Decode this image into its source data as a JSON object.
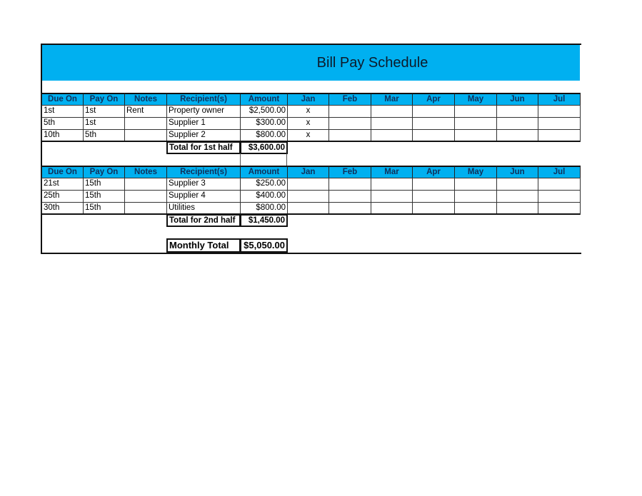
{
  "title": "Bill Pay Schedule",
  "columns": [
    "Due On",
    "Pay On",
    "Notes",
    "Recipient(s)",
    "Amount",
    "Jan",
    "Feb",
    "Mar",
    "Apr",
    "May",
    "Jun",
    "Jul"
  ],
  "first_half": {
    "rows": [
      {
        "due_on": "1st",
        "pay_on": "1st",
        "notes": "Rent",
        "recipient": "Property owner",
        "amount": "$2,500.00",
        "months": [
          "x",
          "",
          "",
          "",
          "",
          "",
          ""
        ]
      },
      {
        "due_on": "5th",
        "pay_on": "1st",
        "notes": "",
        "recipient": "Supplier 1",
        "amount": "$300.00",
        "months": [
          "x",
          "",
          "",
          "",
          "",
          "",
          ""
        ]
      },
      {
        "due_on": "10th",
        "pay_on": "5th",
        "notes": "",
        "recipient": "Supplier 2",
        "amount": "$800.00",
        "months": [
          "x",
          "",
          "",
          "",
          "",
          "",
          ""
        ]
      }
    ],
    "total_label": "Total for 1st half",
    "total_value": "$3,600.00"
  },
  "second_half": {
    "rows": [
      {
        "due_on": "21st",
        "pay_on": "15th",
        "notes": "",
        "recipient": "Supplier 3",
        "amount": "$250.00",
        "months": [
          "",
          "",
          "",
          "",
          "",
          "",
          ""
        ]
      },
      {
        "due_on": "25th",
        "pay_on": "15th",
        "notes": "",
        "recipient": "Supplier 4",
        "amount": "$400.00",
        "months": [
          "",
          "",
          "",
          "",
          "",
          "",
          ""
        ]
      },
      {
        "due_on": "30th",
        "pay_on": "15th",
        "notes": "",
        "recipient": "Utilities",
        "amount": "$800.00",
        "months": [
          "",
          "",
          "",
          "",
          "",
          "",
          ""
        ]
      }
    ],
    "total_label": "Total for 2nd half",
    "total_value": "$1,450.00"
  },
  "monthly_total_label": "Monthly Total",
  "monthly_total_value": "$5,050.00",
  "colors": {
    "header_fill": "#00B0F0",
    "header_text": "#10305a"
  }
}
